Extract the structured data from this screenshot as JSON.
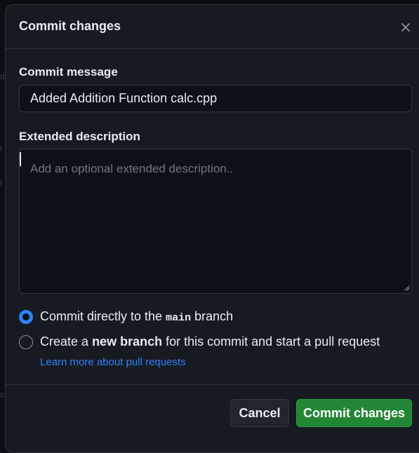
{
  "dialog": {
    "title": "Commit changes",
    "close_icon": "close-icon"
  },
  "commit_message": {
    "label": "Commit message",
    "value": "Added Addition Function calc.cpp"
  },
  "extended_description": {
    "label": "Extended description",
    "placeholder": "Add an optional extended description..",
    "value": ""
  },
  "branch_options": {
    "direct": {
      "prefix": "Commit directly to the",
      "branch": "main",
      "suffix": "branch",
      "checked": true
    },
    "new_branch": {
      "prefix": "Create a",
      "emphasis": "new branch",
      "suffix": "for this commit and start a pull request",
      "checked": false
    },
    "learn_more": "Learn more about pull requests"
  },
  "footer": {
    "cancel_label": "Cancel",
    "commit_label": "Commit changes"
  },
  "colors": {
    "accent": "#2f81f7",
    "primary_button": "#238636",
    "background": "#161b22",
    "border": "#30363d"
  }
}
